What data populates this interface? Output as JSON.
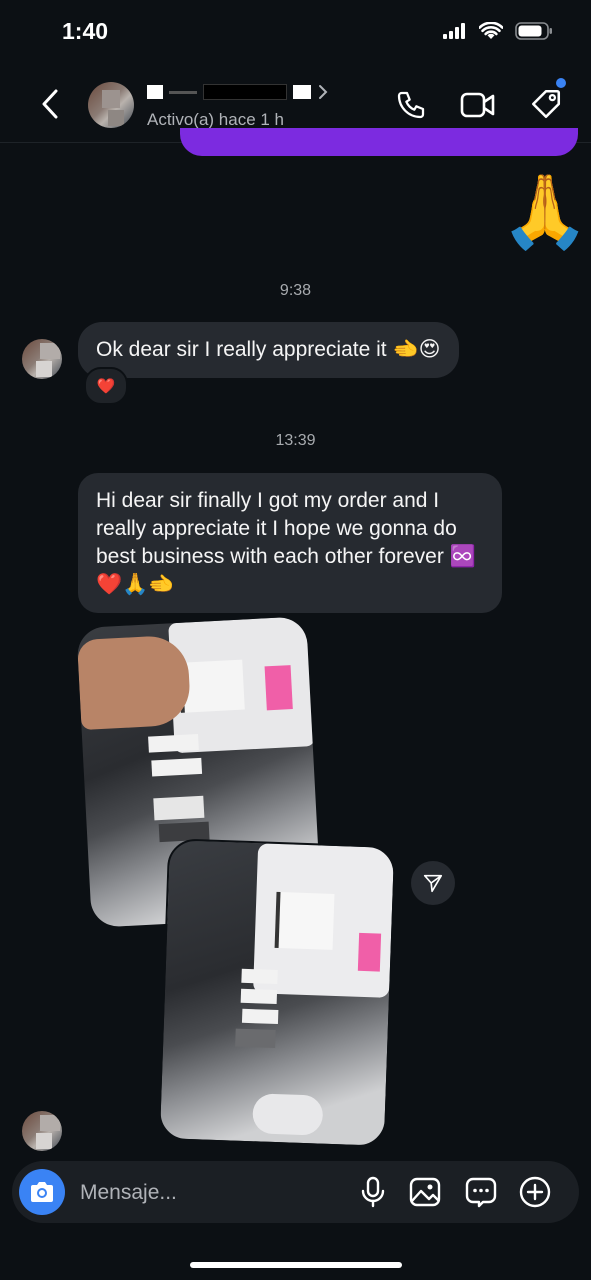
{
  "status_bar": {
    "time": "1:40"
  },
  "header": {
    "status": "Activo(a) hace 1 h"
  },
  "sent": {
    "emoji": "🙏"
  },
  "messages": [
    {
      "timestamp": "9:38",
      "text": "Ok dear sir I really appreciate it 🫲😍",
      "reaction": "❤️"
    },
    {
      "timestamp": "13:39",
      "text": "Hi dear sir finally I got my order and I really appreciate it I hope we gonna do best business with each other forever ♾️❤️🙏🫲"
    }
  ],
  "composer": {
    "placeholder": "Mensaje..."
  },
  "colors": {
    "accent": "#3a83f4",
    "sent_bubble": "#7c2be0",
    "received_bubble": "#262a30",
    "background": "#0c1014"
  }
}
